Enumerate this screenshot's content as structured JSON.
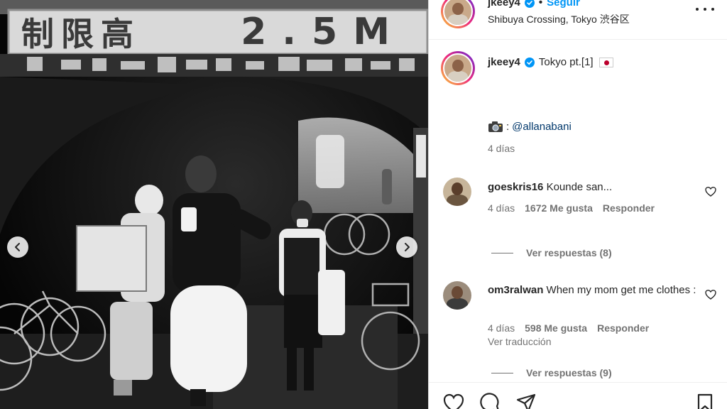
{
  "photo": {
    "sign_kanji": "制限高",
    "sign_height": "2.5M",
    "prev_icon": "chevron-left-icon",
    "next_icon": "chevron-right-icon"
  },
  "header": {
    "username": "jkeey4",
    "separator": "•",
    "follow_label": "Seguir",
    "location": "Shibuya Crossing, Tokyo 渋谷区",
    "more_icon": "more-horizontal-icon"
  },
  "caption": {
    "username": "jkeey4",
    "text": "Tokyo pt.[1]",
    "emoji_icon": "japan-flag-icon",
    "credit_icon": "camera-icon",
    "credit_separator": ":",
    "mention": "@allanabani",
    "time": "4 días"
  },
  "comments": [
    {
      "username": "goeskris16",
      "text": "Kounde san...",
      "time": "4 días",
      "likes": "1672 Me gusta",
      "reply_label": "Responder",
      "view_replies": "Ver respuestas (8)"
    },
    {
      "username": "om3ralwan",
      "text": "When my mom get me clothes :",
      "time": "4 días",
      "likes": "598 Me gusta",
      "reply_label": "Responder",
      "translation": "Ver traducción",
      "view_replies": "Ver respuestas (9)"
    }
  ],
  "actions": {
    "icons": [
      "heart-icon",
      "comment-icon",
      "share-icon",
      "bookmark-icon"
    ]
  },
  "colors": {
    "accent": "#0095f6",
    "verified": "#0095f6",
    "mention": "#00376b",
    "secondary_text": "#737373"
  }
}
